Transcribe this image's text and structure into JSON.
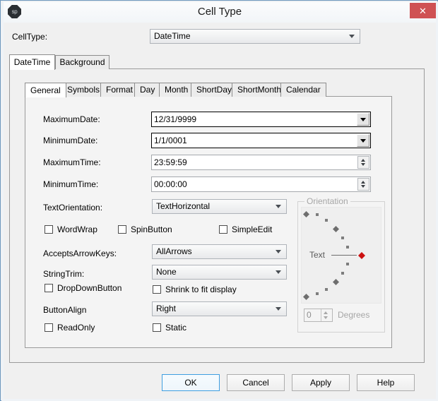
{
  "window": {
    "title": "Cell Type",
    "icon": "sp",
    "close_label": "✕"
  },
  "celltype": {
    "label": "CellType:",
    "value": "DateTime",
    "options": [
      "DateTime"
    ]
  },
  "outer_tabs": [
    {
      "label": "DateTime",
      "selected": true
    },
    {
      "label": "Background",
      "selected": false
    }
  ],
  "inner_tabs": [
    {
      "label": "General",
      "selected": true
    },
    {
      "label": "Symbols",
      "selected": false
    },
    {
      "label": "Format",
      "selected": false
    },
    {
      "label": "Day",
      "selected": false
    },
    {
      "label": "Month",
      "selected": false
    },
    {
      "label": "ShortDay",
      "selected": false
    },
    {
      "label": "ShortMonth",
      "selected": false
    },
    {
      "label": "Calendar",
      "selected": false
    }
  ],
  "general": {
    "maximum_date": {
      "label": "MaximumDate:",
      "value": "12/31/9999"
    },
    "minimum_date": {
      "label": "MinimumDate:",
      "value": "1/1/0001"
    },
    "maximum_time": {
      "label": "MaximumTime:",
      "value": "23:59:59"
    },
    "minimum_time": {
      "label": "MinimumTime:",
      "value": "00:00:00"
    },
    "text_orientation": {
      "label": "TextOrientation:",
      "value": "TextHorizontal",
      "options": [
        "TextHorizontal"
      ]
    },
    "accepts_arrow_keys": {
      "label": "AcceptsArrowKeys:",
      "value": "AllArrows",
      "options": [
        "AllArrows"
      ]
    },
    "string_trim": {
      "label": "StringTrim:",
      "value": "None",
      "options": [
        "None"
      ]
    },
    "button_align": {
      "label": "ButtonAlign",
      "value": "Right",
      "options": [
        "Right"
      ]
    },
    "checkboxes": {
      "word_wrap": {
        "label": "WordWrap",
        "checked": false
      },
      "spin_button": {
        "label": "SpinButton",
        "checked": false
      },
      "simple_edit": {
        "label": "SimpleEdit",
        "checked": false
      },
      "drop_down_button": {
        "label": "DropDownButton",
        "checked": false
      },
      "shrink_to_fit": {
        "label": "Shrink to fit display",
        "checked": false
      },
      "read_only": {
        "label": "ReadOnly",
        "checked": false
      },
      "static": {
        "label": "Static",
        "checked": false
      }
    }
  },
  "orientation": {
    "legend": "Orientation",
    "text_sample": "Text",
    "degrees_value": "0",
    "degrees_label": "Degrees",
    "enabled": false,
    "marker_color": "#6e6e6e",
    "selected_marker_color": "#cc1111"
  },
  "buttons": {
    "ok": "OK",
    "cancel": "Cancel",
    "apply": "Apply",
    "help": "Help"
  }
}
